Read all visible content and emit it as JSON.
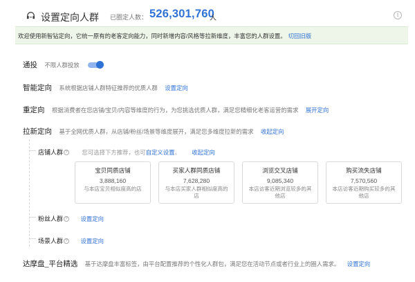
{
  "header": {
    "title": "设置定向人群",
    "count_label": "已圈定人数：",
    "count_value": "526,301,760",
    "count_unit": "人",
    "info_symbol": "i"
  },
  "notice": {
    "text": "欢迎使用新智钻定向，它统一原有的老客定向能力，同时新增内容/风格等拉新维度，丰富您的人群设置。",
    "link": "切回旧版"
  },
  "targeting": {
    "general": {
      "label": "通投",
      "desc": "不限人群投放",
      "enabled": true
    },
    "smart": {
      "label": "智能定向",
      "desc": "系统根据店铺人群特征推荐的优质人群",
      "link": "设置定向"
    },
    "retarget": {
      "label": "重定向",
      "desc": "根据消费者在您店铺/宝贝/内容等维度的行为，为您挑选优质人群，满足您精细化老客运营的需求",
      "link": "展开定向"
    },
    "acquisition": {
      "label": "拉新定向",
      "desc": "基于全网优质人群，从店铺/粉丝/场景等维度展开，满足您多维度拉新的需求",
      "link": "收起定向",
      "shop": {
        "label": "店铺人群",
        "help": "?",
        "hint_prefix": "您可选择下方推荐，也可",
        "hint_link": "自定义设置",
        "hint_suffix": "。",
        "link": "收起定向",
        "cards": [
          {
            "title": "宝贝同质店铺",
            "value": "3,888,160",
            "desc": "与本店宝贝相似度高的店"
          },
          {
            "title": "买家人群同质店铺",
            "value": "7,628,280",
            "desc": "与本店买家人群相似度高的店"
          },
          {
            "title": "浏览交叉店铺",
            "value": "9,085,340",
            "desc": "本店访客近期浏览较多的其他店"
          },
          {
            "title": "购买流失店铺",
            "value": "7,570,560",
            "desc": "本店访客近期购买较多的其他店"
          }
        ]
      },
      "fans": {
        "label": "粉丝人群",
        "help": "?",
        "link": "设置定向"
      },
      "scene": {
        "label": "场景人群",
        "help": "?",
        "link": "设置定向"
      }
    },
    "dmp": {
      "label": "达摩盘_平台精选",
      "desc": "基于达摩盘丰富标签，由平台配置推荐的个性化人群包，满足您在活动节点或者行业上的圈人需求。",
      "link": "设置定向"
    }
  },
  "colors": {
    "accent": "#2f72d6",
    "notice_bg": "#edf6e8",
    "toggle_track": "#8fb4ee"
  }
}
